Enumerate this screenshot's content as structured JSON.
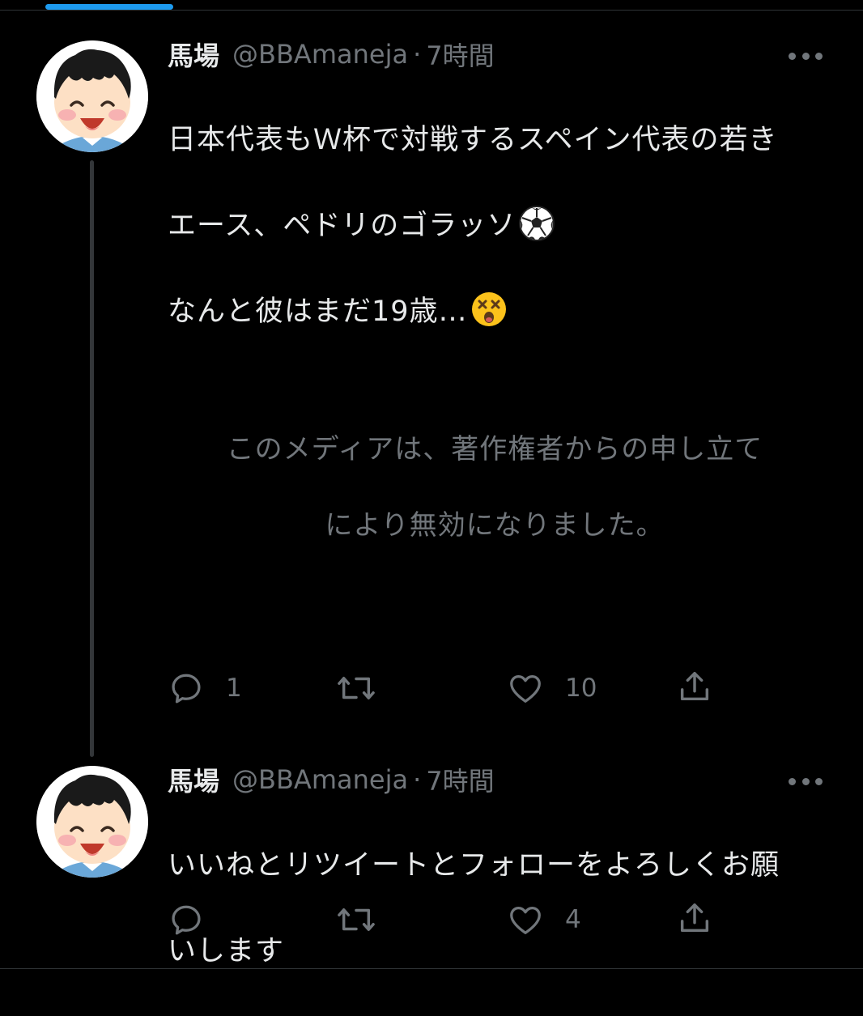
{
  "tweets": [
    {
      "author": {
        "name": "馬場",
        "handle": "@BBAmaneja",
        "dot": "·",
        "time": "7時間"
      },
      "text_lines": [
        "日本代表もＷ杯で対戦するスペイン代表の若き",
        "エース、ペドリのゴラッソ",
        "なんと彼はまだ19歳…"
      ],
      "emojis": [
        "soccer-ball-emoji",
        "dizzy-face-emoji"
      ],
      "media_notice_lines": [
        "このメディアは、著作権者からの申し立て",
        "により無効になりました。"
      ],
      "actions": {
        "reply_count": "1",
        "retweet_count": "",
        "like_count": "10"
      }
    },
    {
      "author": {
        "name": "馬場",
        "handle": "@BBAmaneja",
        "dot": "·",
        "time": "7時間"
      },
      "text_lines": [
        "いいねとリツイートとフォローをよろしくお願",
        "いします"
      ],
      "actions": {
        "reply_count": "",
        "retweet_count": "",
        "like_count": "4"
      }
    }
  ],
  "icons": [
    "reply-icon",
    "retweet-icon",
    "like-icon",
    "share-icon",
    "more-options-icon"
  ],
  "colors": {
    "background": "#000000",
    "text_primary": "#e7e9ea",
    "text_secondary": "#71767b",
    "accent": "#1d9bf0",
    "thread_line": "#333639"
  }
}
